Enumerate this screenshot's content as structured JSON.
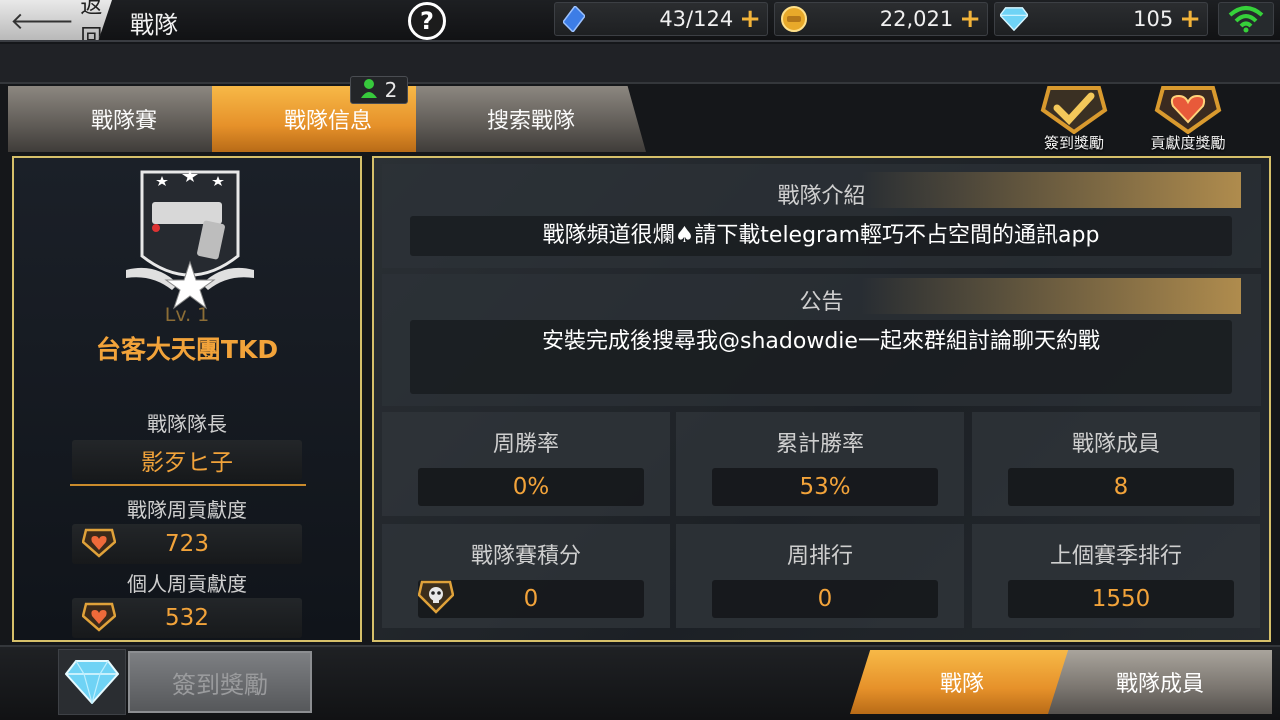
{
  "topbar": {
    "back_label": "返回",
    "title": "戰隊",
    "help_label": "?",
    "resources": [
      {
        "icon": "energy-crystal-icon",
        "value": "43/124",
        "plus": "+"
      },
      {
        "icon": "gold-coin-icon",
        "value": "22,021",
        "plus": "+"
      },
      {
        "icon": "diamond-icon",
        "value": "105",
        "plus": "+"
      }
    ],
    "wifi_icon": "wifi-icon"
  },
  "tabs": [
    {
      "label": "戰隊賽",
      "active": false
    },
    {
      "label": "戰隊信息",
      "active": true
    },
    {
      "label": "搜索戰隊",
      "active": false
    }
  ],
  "member_badge": {
    "count": "2"
  },
  "rewards": {
    "signin_label": "簽到獎勵",
    "contribution_label": "貢獻度獎勵"
  },
  "team": {
    "level": "Lv. 1",
    "name": "台客大天團TKD",
    "leader_label": "戰隊隊長",
    "leader_name": "影歹ヒ子",
    "weekly_contrib_label": "戰隊周貢獻度",
    "weekly_contrib_value": "723",
    "personal_contrib_label": "個人周貢獻度",
    "personal_contrib_value": "532"
  },
  "intro": {
    "title": "戰隊介紹",
    "text": "戰隊頻道很爛♠請下載telegram輕巧不占空間的通訊app"
  },
  "notice": {
    "title": "公告",
    "text": "安裝完成後搜尋我@shadowdie一起來群組討論聊天約戰"
  },
  "stats": {
    "weekly_win_rate_label": "周勝率",
    "weekly_win_rate": "0%",
    "total_win_rate_label": "累計勝率",
    "total_win_rate": "53%",
    "members_label": "戰隊成員",
    "members": "8",
    "battle_points_label": "戰隊賽積分",
    "battle_points": "0",
    "weekly_rank_label": "周排行",
    "weekly_rank": "0",
    "last_season_rank_label": "上個賽季排行",
    "last_season_rank": "1550"
  },
  "bottom": {
    "signin_button": "簽到獎勵",
    "tab_team": "戰隊",
    "tab_members": "戰隊成員"
  },
  "colors": {
    "accent_orange": "#f2a33a",
    "panel_border": "#d6c06a",
    "tab_active": "#e6912a"
  }
}
